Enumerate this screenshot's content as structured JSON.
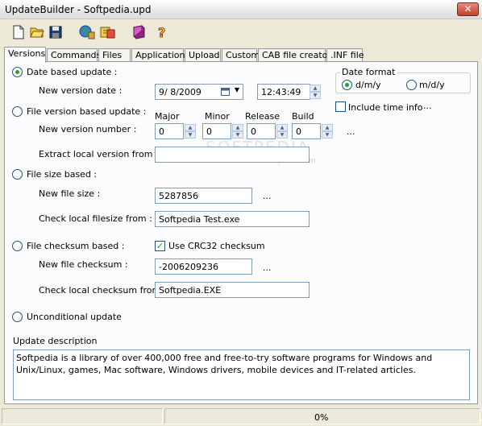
{
  "window": {
    "title": "UpdateBuilder - Softpedia.upd",
    "close_label": "✕"
  },
  "toolbar": [
    {
      "name": "new-file-icon"
    },
    {
      "name": "open-folder-icon"
    },
    {
      "name": "save-icon"
    },
    {
      "name": "publish-globe-icon"
    },
    {
      "name": "import-icon"
    },
    {
      "name": "help-book-icon"
    },
    {
      "name": "about-question-icon"
    }
  ],
  "tabs": [
    "Versions",
    "Commands",
    "Files",
    "Application",
    "Upload",
    "Custom",
    "CAB file creator",
    ".INF file"
  ],
  "active_tab": "Versions",
  "versions": {
    "date_based": {
      "label": "Date based update :",
      "selected": true,
      "new_version_date_label": "New version date :",
      "date_value": "9/  8/2009",
      "time_value": "12:43:49"
    },
    "date_format": {
      "legend": "Date format",
      "options": [
        "d/m/y",
        "m/d/y"
      ],
      "selected": "d/m/y"
    },
    "include_time_info": {
      "label": "Include time info",
      "checked": false,
      "more": "..."
    },
    "file_version_based": {
      "label": "File version based update :",
      "selected": false,
      "new_version_number_label": "New version number :",
      "headers": [
        "Major",
        "Minor",
        "Release",
        "Build"
      ],
      "values": [
        "0",
        "0",
        "0",
        "0"
      ],
      "more": "...",
      "extract_label": "Extract local version from :",
      "extract_value": ""
    },
    "file_size_based": {
      "label": "File size based :",
      "selected": false,
      "new_file_size_label": "New file size :",
      "new_file_size_value": "5287856",
      "more": "...",
      "check_local_label": "Check local filesize from :",
      "check_local_value": "Softpedia Test.exe"
    },
    "file_checksum_based": {
      "label": "File checksum based :",
      "selected": false,
      "use_crc_label": "Use CRC32 checksum",
      "use_crc_checked": true,
      "new_checksum_label": "New file checksum :",
      "new_checksum_value": "-2006209236",
      "more": "...",
      "check_local_label": "Check local checksum from :",
      "check_local_value": "Softpedia.EXE"
    },
    "unconditional": {
      "label": "Unconditional update",
      "selected": false
    },
    "description": {
      "label": "Update description",
      "text": "Softpedia is a library of over 400,000 free and free-to-try software programs for Windows and Unix/Linux, games, Mac software, Windows drivers, mobile devices and IT-related articles."
    }
  },
  "watermark": {
    "main": "SOFTPEDIA",
    "sub": "www.softpedia.com"
  },
  "status": {
    "progress": "0%"
  }
}
